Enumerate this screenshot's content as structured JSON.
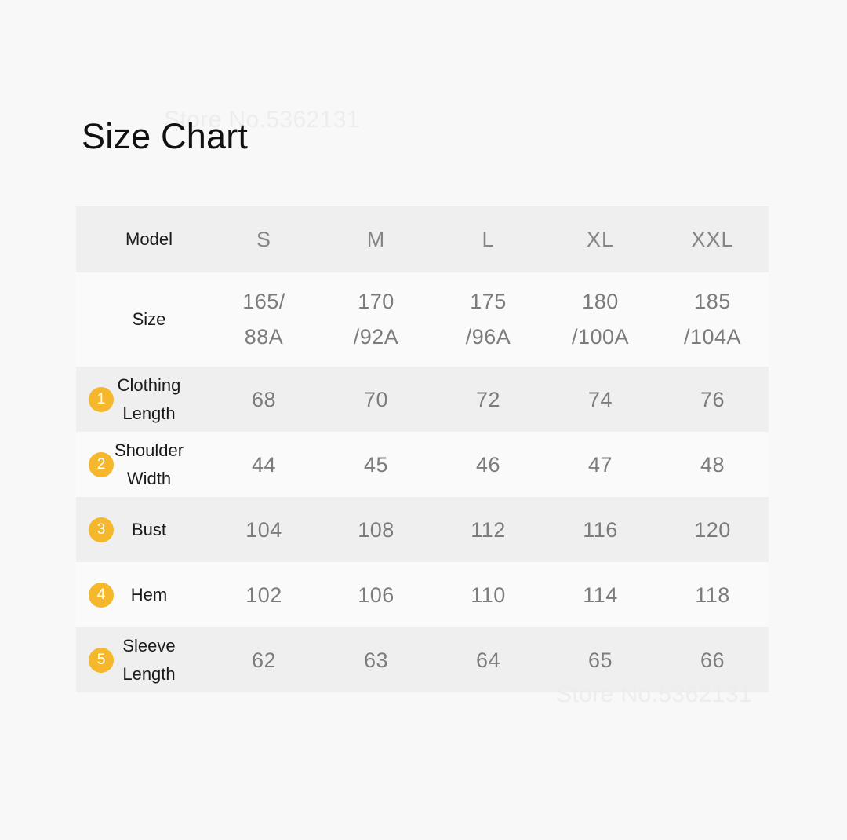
{
  "title": "Size Chart",
  "watermark": {
    "top": "Store No.5362131",
    "bottom": "Store No.5362131"
  },
  "colors": {
    "page_background": "#F8F8F8",
    "band_dark": "#EFEFEF",
    "band_light": "#FAFAFA",
    "badge": "#F5B72C",
    "badge_text": "#FFFFFF",
    "label_text": "#1A1A1A",
    "value_text": "#7C7C7C",
    "watermark": "#EDEDED"
  },
  "chart_data": {
    "type": "table",
    "title": "Size Chart",
    "columns": [
      "Model",
      "S",
      "M",
      "L",
      "XL",
      "XXL"
    ],
    "rows": [
      {
        "index": "",
        "label": "Size",
        "values": [
          "165/\n88A",
          "170\n/92A",
          "175\n/96A",
          "180\n/100A",
          "185\n/104A"
        ]
      },
      {
        "index": "1",
        "label": "Clothing Length",
        "values": [
          "68",
          "70",
          "72",
          "74",
          "76"
        ]
      },
      {
        "index": "2",
        "label": "Shoulder Width",
        "values": [
          "44",
          "45",
          "46",
          "47",
          "48"
        ]
      },
      {
        "index": "3",
        "label": "Bust",
        "values": [
          "104",
          "108",
          "112",
          "116",
          "120"
        ]
      },
      {
        "index": "4",
        "label": "Hem",
        "values": [
          "102",
          "106",
          "110",
          "114",
          "118"
        ]
      },
      {
        "index": "5",
        "label": "Sleeve Length",
        "values": [
          "62",
          "63",
          "64",
          "65",
          "66"
        ]
      }
    ]
  },
  "table": {
    "header": {
      "label": "Model",
      "sizes": [
        "S",
        "M",
        "L",
        "XL",
        "XXL"
      ]
    },
    "size_row": {
      "label": "Size",
      "values": [
        "165/\n88A",
        "170\n/92A",
        "175\n/96A",
        "180\n/100A",
        "185\n/104A"
      ]
    },
    "measurements": [
      {
        "badge": "1",
        "label": "Clothing Length",
        "values": [
          "68",
          "70",
          "72",
          "74",
          "76"
        ]
      },
      {
        "badge": "2",
        "label": "Shoulder Width",
        "values": [
          "44",
          "45",
          "46",
          "47",
          "48"
        ]
      },
      {
        "badge": "3",
        "label": "Bust",
        "values": [
          "104",
          "108",
          "112",
          "116",
          "120"
        ]
      },
      {
        "badge": "4",
        "label": "Hem",
        "values": [
          "102",
          "106",
          "110",
          "114",
          "118"
        ]
      },
      {
        "badge": "5",
        "label": "Sleeve Length",
        "values": [
          "62",
          "63",
          "64",
          "65",
          "66"
        ]
      }
    ]
  }
}
